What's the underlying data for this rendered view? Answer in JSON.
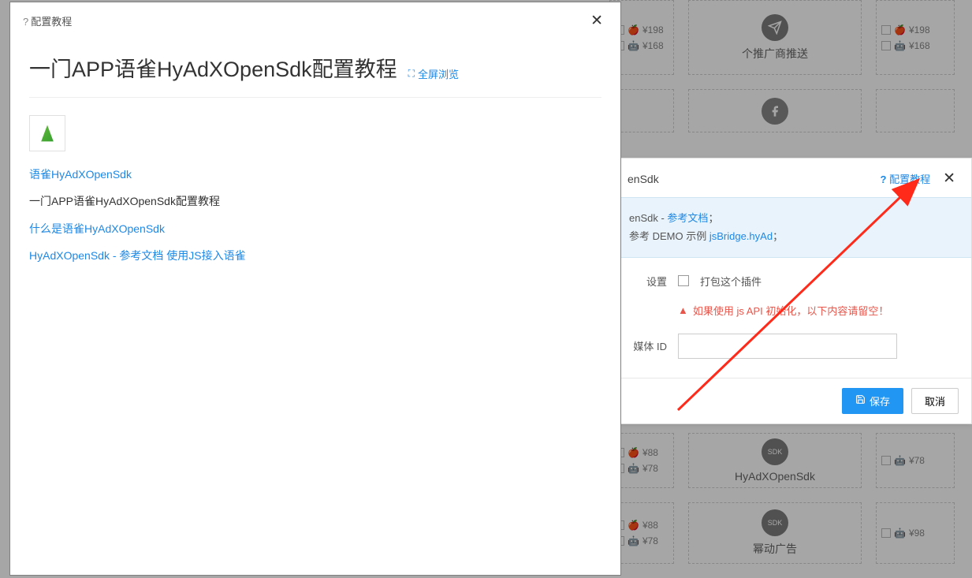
{
  "modal": {
    "header_label": "配置教程",
    "title": "一门APP语雀HyAdXOpenSdk配置教程",
    "fullscreen": "全屏浏览",
    "link1": "语雀HyAdXOpenSdk",
    "line2": "一门APP语雀HyAdXOpenSdk配置教程",
    "link3": "什么是语雀HyAdXOpenSdk",
    "link4a": "HyAdXOpenSdk - 参考文档",
    "link4b": "使用JS接入语雀"
  },
  "config": {
    "title_suffix": "enSdk",
    "tutorial_link": "配置教程",
    "info_line1a": "enSdk - ",
    "info_link1": "参考文档",
    "info_line1b": "；",
    "info_line2a": "参考 DEMO 示例 ",
    "info_link2": "jsBridge.hyAd",
    "info_line2b": "；",
    "settings_label": "设置",
    "pack_plugin": "打包这个插件",
    "warn": "如果使用 js API 初始化，以下内容请留空！",
    "media_id_label": "媒体 ID",
    "save": "保存",
    "cancel": "取消"
  },
  "cards": {
    "row0_left_apple": "¥198",
    "row0_left_android": "¥168",
    "row0_mid_name": "个推广商推送",
    "row0_right_apple": "¥198",
    "row0_right_android": "¥168",
    "row3_left_apple": "¥88",
    "row3_left_android": "¥78",
    "row3_mid_name": "HyAdXOpenSdk",
    "row3_right_android": "¥78",
    "row4_left_apple": "¥88",
    "row4_left_android": "¥78",
    "row4_mid_name": "幂动广告",
    "row4_right_android": "¥98",
    "sdk_label": "SDK"
  }
}
